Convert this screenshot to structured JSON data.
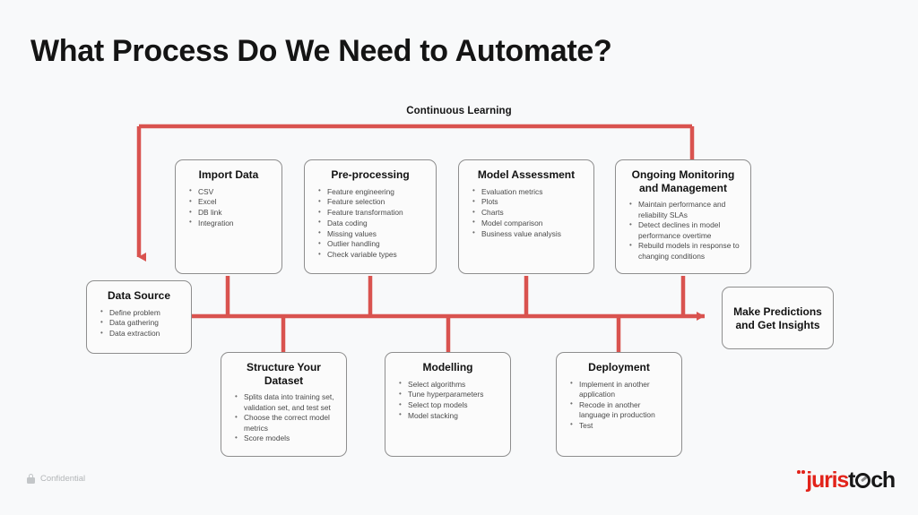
{
  "slide": {
    "title": "What Process Do We Need to Automate?",
    "background_color": "#f8f9fa",
    "accent_color": "#d9534f"
  },
  "diagram": {
    "loop_label": "Continuous Learning",
    "nodes": [
      {
        "id": "import-data",
        "title": "Import Data",
        "items": [
          "CSV",
          "Excel",
          "DB link",
          "Integration"
        ]
      },
      {
        "id": "pre-processing",
        "title": "Pre-processing",
        "items": [
          "Feature engineering",
          "Feature selection",
          "Feature transformation",
          "Data coding",
          "Missing values",
          "Outlier handling",
          "Check variable types"
        ]
      },
      {
        "id": "model-assessment",
        "title": "Model Assessment",
        "items": [
          "Evaluation metrics",
          "Plots",
          "Charts",
          "Model comparison",
          "Business value analysis"
        ]
      },
      {
        "id": "ongoing-monitoring",
        "title": "Ongoing Monitoring and Management",
        "items": [
          "Maintain performance and reliability SLAs",
          "Detect declines in model performance overtime",
          "Rebuild models in response to changing conditions"
        ]
      },
      {
        "id": "data-source",
        "title": "Data Source",
        "items": [
          "Define problem",
          "Data gathering",
          "Data extraction"
        ]
      },
      {
        "id": "structure-your-dataset",
        "title": "Structure Your Dataset",
        "items": [
          "Splits data into training set, validation set, and test set",
          "Choose the correct model metrics",
          "Score models"
        ]
      },
      {
        "id": "modelling",
        "title": "Modelling",
        "items": [
          "Select algorithms",
          "Tune hyperparameters",
          "Select top models",
          "Model stacking"
        ]
      },
      {
        "id": "deployment",
        "title": "Deployment",
        "items": [
          "Implement in another application",
          "Recode in another language in production",
          "Test"
        ]
      },
      {
        "id": "make-predictions",
        "title": "Make Predictions and Get Insights",
        "items": []
      }
    ]
  },
  "footer": {
    "confidential_label": "Confidential",
    "lock_icon": "lock-icon",
    "logo": {
      "name_red": "juris",
      "name_black_pre": "t",
      "name_black_post": "ch",
      "red_color": "#e2231a",
      "black_color": "#171717"
    }
  }
}
